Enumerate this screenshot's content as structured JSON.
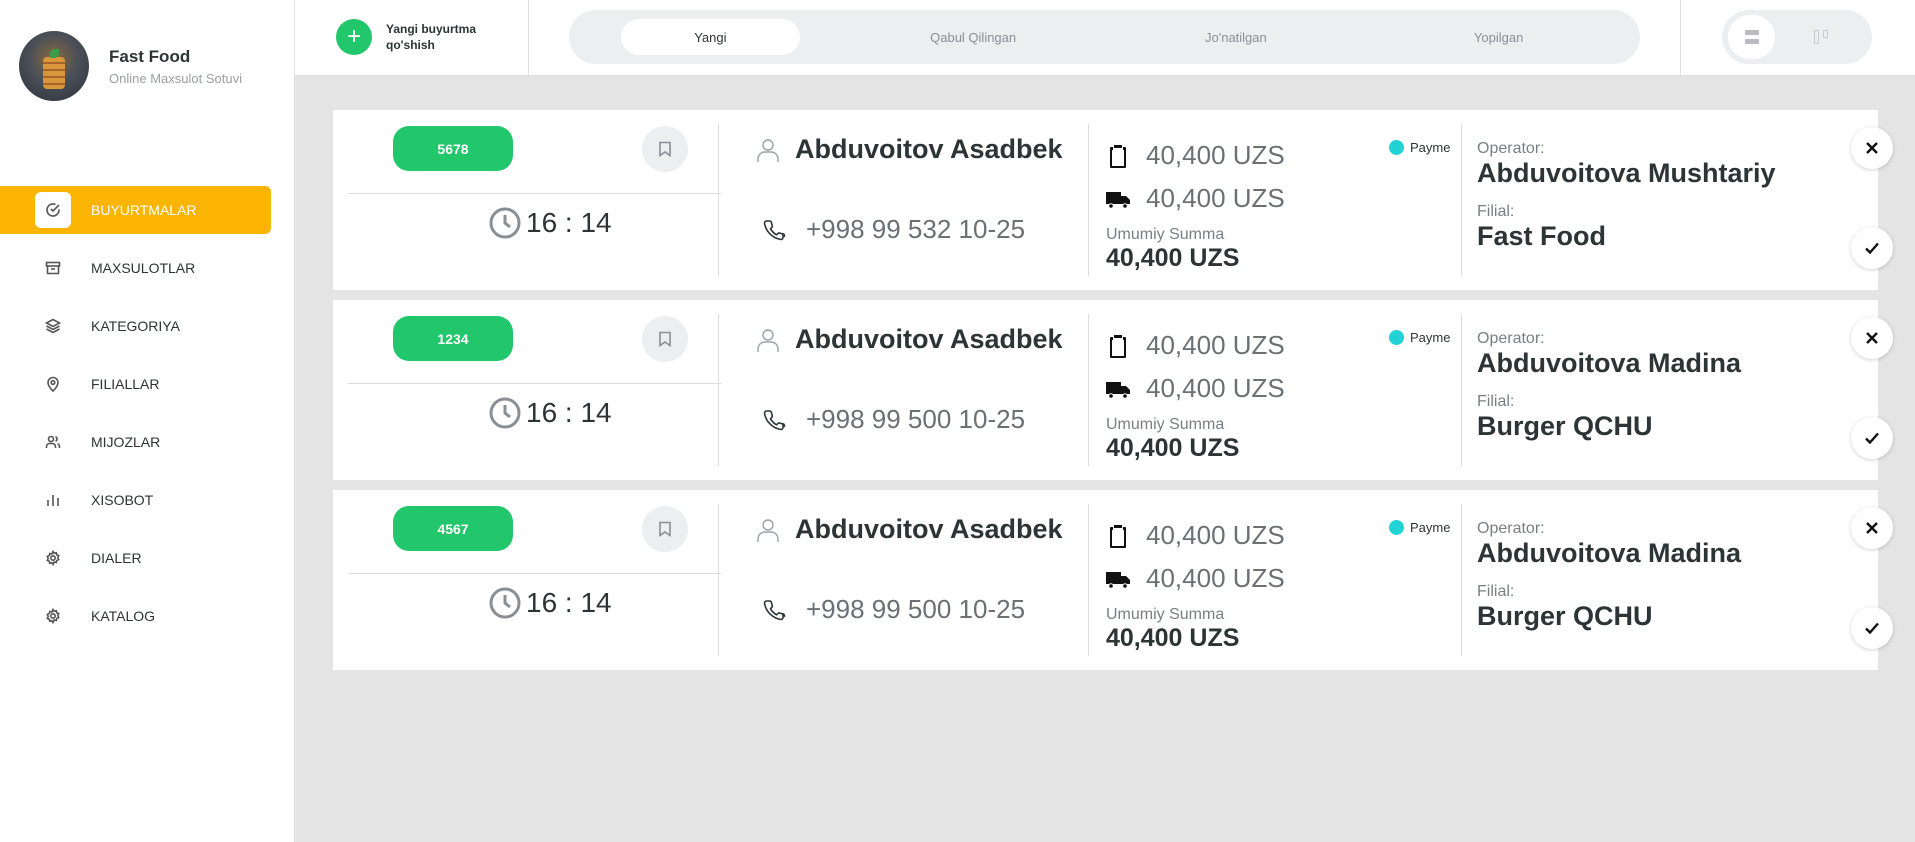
{
  "brand": {
    "title": "Fast Food",
    "subtitle": "Online Maxsulot Sotuvi"
  },
  "sidebar": {
    "items": [
      {
        "label": "BUYURTMALAR",
        "icon": "check-circle-icon",
        "active": true
      },
      {
        "label": "MAXSULOTLAR",
        "icon": "archive-box-icon",
        "active": false
      },
      {
        "label": "KATEGORIYA",
        "icon": "layers-icon",
        "active": false
      },
      {
        "label": "FILIALLAR",
        "icon": "map-pin-icon",
        "active": false
      },
      {
        "label": "MIJOZLAR",
        "icon": "users-icon",
        "active": false
      },
      {
        "label": "XISOBOT",
        "icon": "bar-chart-icon",
        "active": false
      },
      {
        "label": "DIALER",
        "icon": "gear-icon",
        "active": false
      },
      {
        "label": "KATALOG",
        "icon": "gear-icon",
        "active": false
      }
    ],
    "active_color": "#fbb400"
  },
  "header": {
    "add_new_label": "Yangi buyurtma qo'shish",
    "tabs": [
      {
        "label": "Yangi",
        "active": true
      },
      {
        "label": "Qabul Qilingan",
        "active": false
      },
      {
        "label": "Jo'natilgan",
        "active": false
      },
      {
        "label": "Yopilgan",
        "active": false
      }
    ],
    "view_modes": [
      "list-view-icon",
      "columns-view-icon"
    ],
    "active_view": "list-view-icon"
  },
  "orders": [
    {
      "id": "5678",
      "time": "16 : 14",
      "customer": "Abduvoitov Asadbek",
      "phone": "+998 99 532 10-25",
      "order_price": "40,400 UZS",
      "delivery_price": "40,400 UZS",
      "total_label": "Umumiy Summa",
      "total": "40,400 UZS",
      "payment": "Payme",
      "operator_label": "Operator:",
      "operator": "Abduvoitova Mushtariy",
      "branch_label": "Filial:",
      "branch": "Fast Food"
    },
    {
      "id": "1234",
      "time": "16 : 14",
      "customer": "Abduvoitov Asadbek",
      "phone": "+998 99 500 10-25",
      "order_price": "40,400 UZS",
      "delivery_price": "40,400 UZS",
      "total_label": "Umumiy Summa",
      "total": "40,400 UZS",
      "payment": "Payme",
      "operator_label": "Operator:",
      "operator": "Abduvoitova Madina",
      "branch_label": "Filial:",
      "branch": "Burger QCHU"
    },
    {
      "id": "4567",
      "time": "16 : 14",
      "customer": "Abduvoitov Asadbek",
      "phone": "+998 99 500 10-25",
      "order_price": "40,400 UZS",
      "delivery_price": "40,400 UZS",
      "total_label": "Umumiy Summa",
      "total": "40,400 UZS",
      "payment": "Payme",
      "operator_label": "Operator:",
      "operator": "Abduvoitova Madina",
      "branch_label": "Filial:",
      "branch": "Burger QCHU"
    }
  ],
  "colors": {
    "accent_green": "#22c66b",
    "accent_yellow": "#fbb400",
    "payme_dot": "#22d3d6",
    "background": "#e4e4e4"
  }
}
